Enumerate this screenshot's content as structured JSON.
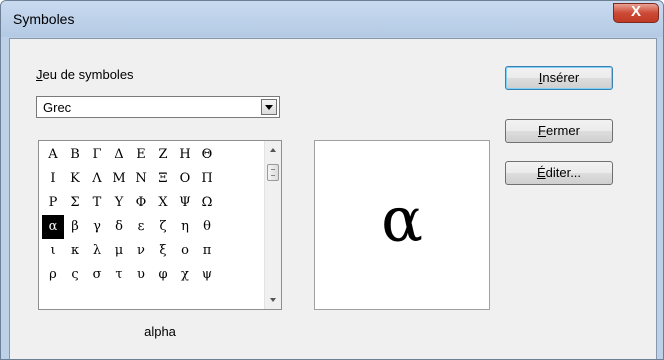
{
  "dialog": {
    "title": "Symboles",
    "close_label": "X"
  },
  "symbol_set": {
    "label_accesskey": "J",
    "label_rest": "eu de symboles",
    "selected": "Grec"
  },
  "grid": {
    "rows": [
      [
        "Α",
        "Β",
        "Γ",
        "Δ",
        "Ε",
        "Ζ",
        "Η",
        "Θ"
      ],
      [
        "Ι",
        "Κ",
        "Λ",
        "Μ",
        "Ν",
        "Ξ",
        "Ο",
        "Π"
      ],
      [
        "Ρ",
        "Σ",
        "Τ",
        "Υ",
        "Φ",
        "Χ",
        "Ψ",
        "Ω"
      ],
      [
        "α",
        "β",
        "γ",
        "δ",
        "ε",
        "ζ",
        "η",
        "θ"
      ],
      [
        "ι",
        "κ",
        "λ",
        "μ",
        "ν",
        "ξ",
        "ο",
        "π"
      ],
      [
        "ρ",
        "ς",
        "σ",
        "τ",
        "υ",
        "φ",
        "χ",
        "ψ"
      ]
    ],
    "selected_row": 3,
    "selected_col": 0
  },
  "selected_char_name": "alpha",
  "preview_char": "α",
  "buttons": {
    "insert": {
      "accesskey": "I",
      "rest": "nsérer"
    },
    "close": {
      "accesskey": "F",
      "rest": "ermer"
    },
    "edit": {
      "accesskey": "É",
      "rest": "diter..."
    }
  },
  "icons": {
    "close": "close-icon",
    "dropdown": "chevron-down-icon",
    "scroll_up": "arrow-up-icon",
    "scroll_down": "arrow-down-icon"
  }
}
